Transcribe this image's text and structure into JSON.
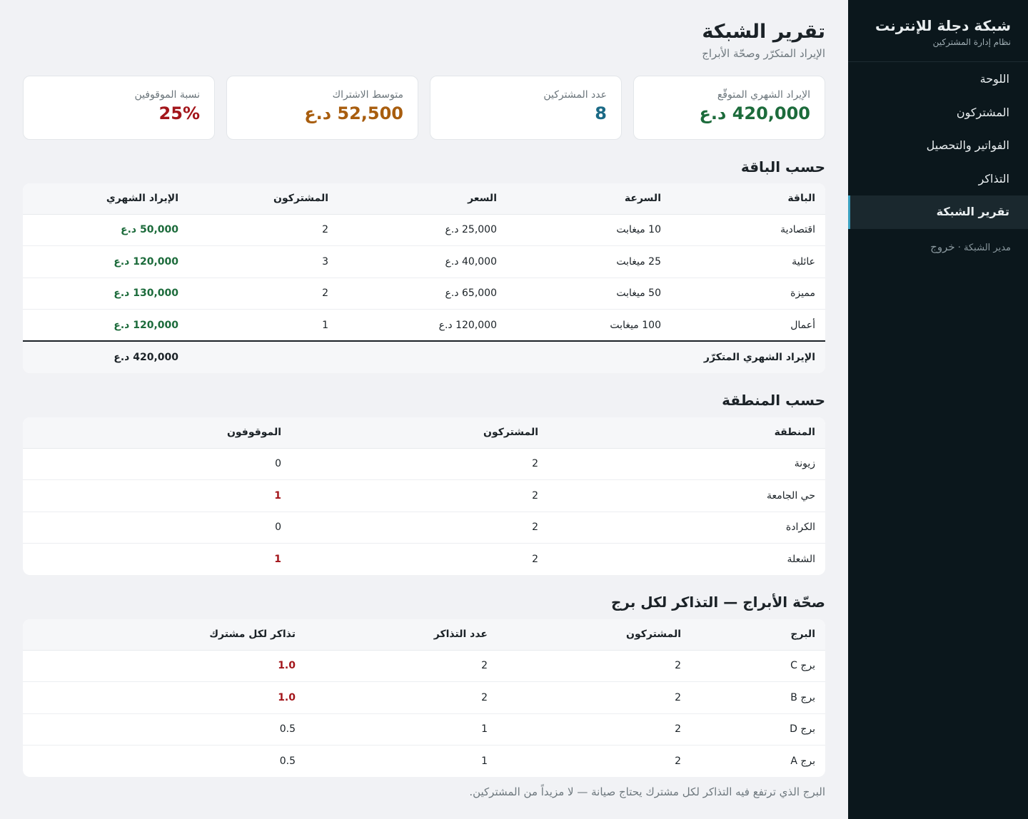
{
  "sidebar": {
    "title": "شبكة دجلة للإنترنت",
    "subtitle": "نظام إدارة المشتركين",
    "items": [
      {
        "label": "اللوحة"
      },
      {
        "label": "المشتركون"
      },
      {
        "label": "الفواتير والتحصيل"
      },
      {
        "label": "التذاكر"
      },
      {
        "label": "تقرير الشبكة"
      }
    ],
    "active_index": 4,
    "user": "مدير الشبكة · ",
    "logout": "خروج"
  },
  "header": {
    "title": "تقرير الشبكة",
    "subtitle": "الإيراد المتكرّر وصحّة الأبراج"
  },
  "cards": [
    {
      "label": "الإيراد الشهري المتوقّع",
      "value": "420,000 د.ع",
      "color": "#1c6b3b"
    },
    {
      "label": "عدد المشتركين",
      "value": "8",
      "color": "#1b6a86"
    },
    {
      "label": "متوسط الاشتراك",
      "value": "52,500 د.ع",
      "color": "#a85d0e"
    },
    {
      "label": "نسبة الموقوفين",
      "value": "25%",
      "color": "#a3161b"
    }
  ],
  "plans": {
    "title": "حسب الباقة",
    "headers": [
      "الباقة",
      "السرعة",
      "السعر",
      "المشتركون",
      "الإيراد الشهري"
    ],
    "rows": [
      [
        "اقتصادية",
        "10 ميغابت",
        "25,000 د.ع",
        "2",
        "50,000 د.ع"
      ],
      [
        "عائلية",
        "25 ميغابت",
        "40,000 د.ع",
        "3",
        "120,000 د.ع"
      ],
      [
        "مميزة",
        "50 ميغابت",
        "65,000 د.ع",
        "2",
        "130,000 د.ع"
      ],
      [
        "أعمال",
        "100 ميغابت",
        "120,000 د.ع",
        "1",
        "120,000 د.ع"
      ]
    ],
    "total_label": "الإيراد الشهري المتكرّر",
    "total_value": "420,000 د.ع"
  },
  "regions": {
    "title": "حسب المنطقة",
    "headers": [
      "المنطقة",
      "المشتركون",
      "الموقوفون"
    ],
    "rows": [
      [
        "زيونة",
        "2",
        "0"
      ],
      [
        "حي الجامعة",
        "2",
        "1"
      ],
      [
        "الكرادة",
        "2",
        "0"
      ],
      [
        "الشعلة",
        "2",
        "1"
      ]
    ]
  },
  "towers": {
    "title": "صحّة الأبراج — التذاكر لكل برج",
    "headers": [
      "البرج",
      "المشتركون",
      "عدد التذاكر",
      "تذاكر لكل مشترك"
    ],
    "rows": [
      [
        "برج C",
        "2",
        "2",
        "1.0"
      ],
      [
        "برج B",
        "2",
        "2",
        "1.0"
      ],
      [
        "برج D",
        "2",
        "1",
        "0.5"
      ],
      [
        "برج A",
        "2",
        "1",
        "0.5"
      ]
    ],
    "note": "البرج الذي ترتفع فيه التذاكر لكل مشترك يحتاج صيانة — لا مزيداً من المشتركين."
  }
}
